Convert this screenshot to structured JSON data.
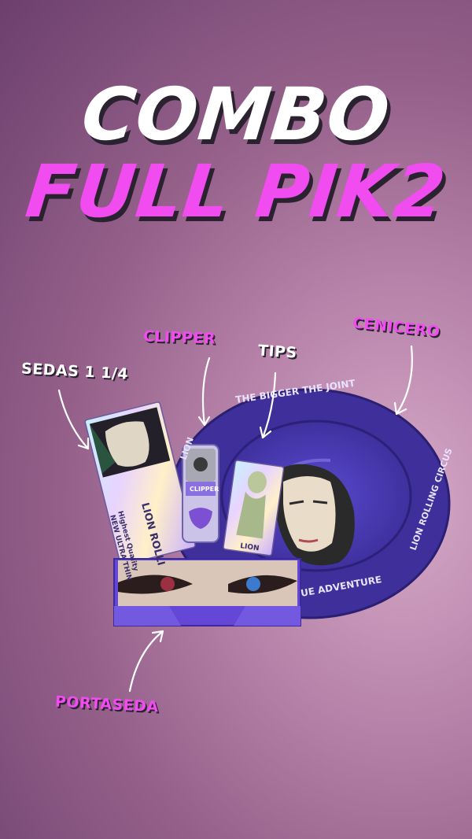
{
  "headline": {
    "line1": "COMBO",
    "line2": "FULL PIK2"
  },
  "labels": {
    "sedas": "SEDAS 1 1/4",
    "clipper": "CLIPPER",
    "tips": "TIPS",
    "cenicero": "CENICERO",
    "portaseda": "PORTASEDA"
  },
  "products": {
    "ashtray_top_text": "THE BIGGER THE JOINT",
    "ashtray_bottom_text": "UE ADVENTURE",
    "ashtray_side_text": "LION ROLLING CIRCUS",
    "ashtray_left_text": "LION",
    "papers_text_1": "Highest Quality",
    "papers_text_2": "NEW ULTRA THIN",
    "papers_brand": "LION ROLLI",
    "lighter_brand": "CLIPPER",
    "tips_brand": "LION"
  },
  "colors": {
    "accent_pink": "#f04cf0",
    "ashtray_purple": "#4b3aa8",
    "headline_white": "#ffffff"
  }
}
